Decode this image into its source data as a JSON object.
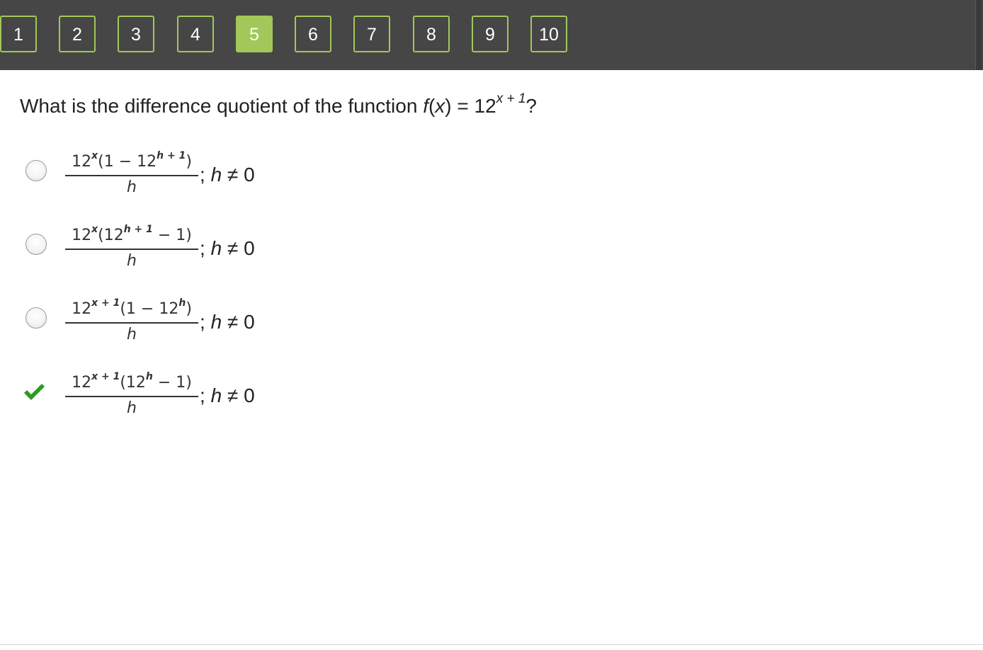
{
  "nav": {
    "buttons": [
      "1",
      "2",
      "3",
      "4",
      "5",
      "6",
      "7",
      "8",
      "9",
      "10"
    ],
    "active": "5",
    "accent_color": "#a3c759",
    "bar_color": "#464646"
  },
  "question": {
    "prefix": "What is the difference quotient of the function ",
    "func_f": "f",
    "paren_open": "(",
    "func_x": "x",
    "paren_close_eq": ") = 12",
    "exponent": "x + 1",
    "suffix": "?"
  },
  "options": [
    {
      "state": "unselected",
      "numerator": {
        "base1": "12",
        "exp1": "x",
        "mid": "(1 − 12",
        "exp2": "h + 1",
        "end": ")"
      },
      "denominator": "h",
      "condition_var": "h",
      "condition_rest": " ≠ 0"
    },
    {
      "state": "unselected",
      "numerator": {
        "base1": "12",
        "exp1": "x",
        "mid": "(12",
        "exp2": "h + 1",
        "end": " − 1)"
      },
      "denominator": "h",
      "condition_var": "h",
      "condition_rest": " ≠ 0"
    },
    {
      "state": "unselected",
      "numerator": {
        "base1": "12",
        "exp1": "x + 1",
        "mid": "(1 − 12",
        "exp2": "h",
        "end": ")"
      },
      "denominator": "h",
      "condition_var": "h",
      "condition_rest": " ≠ 0"
    },
    {
      "state": "correct",
      "numerator": {
        "base1": "12",
        "exp1": "x + 1",
        "mid": "(12",
        "exp2": "h",
        "end": " − 1)"
      },
      "denominator": "h",
      "condition_var": "h",
      "condition_rest": " ≠ 0"
    }
  ],
  "icons": {
    "correct": "checkmark-icon",
    "radio": "radio-button",
    "check_color": "#2e9a22"
  }
}
